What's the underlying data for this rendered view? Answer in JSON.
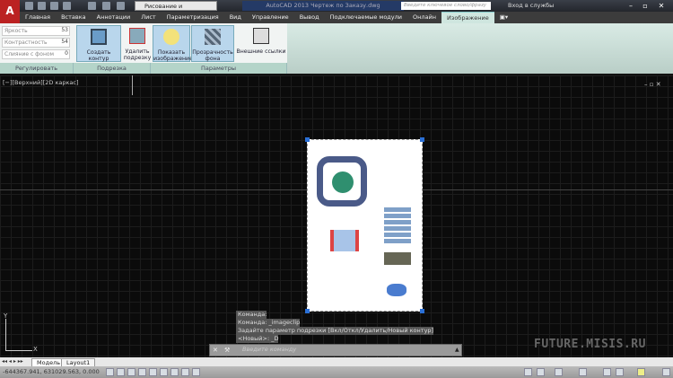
{
  "title_bar": {
    "workspace": "Рисование и аннотации",
    "title": "AutoCAD 2013   Чертеж по Заказу.dwg",
    "search_placeholder": "Введите ключевое слово/фразу",
    "login": "Вход в службы",
    "logo": "A"
  },
  "tabs": [
    "Главная",
    "Вставка",
    "Аннотации",
    "Лист",
    "Параметризация",
    "Вид",
    "Управление",
    "Вывод",
    "Подключаемые модули",
    "Онлайн",
    "Изображение"
  ],
  "active_tab": "Изображение",
  "ribbon": {
    "adjust": {
      "rows": [
        {
          "label": "Яркость",
          "value": "53"
        },
        {
          "label": "Контрастность",
          "value": "54"
        },
        {
          "label": "Слияние с фоном",
          "value": "0"
        }
      ],
      "panel": "Регулировать"
    },
    "clip": {
      "buttons": [
        "Создать контур подрезки",
        "Удалить подрезку"
      ],
      "panel": "Подрезка"
    },
    "options": {
      "buttons": [
        "Показать изображение",
        "Прозрачность фона",
        "Внешние ссылки"
      ],
      "panel": "Параметры"
    }
  },
  "viewport_label": "[−][Верхний][2D каркас]",
  "command": {
    "history": [
      "Команда:",
      "Команда:  _imageclip",
      "Задайте параметр подрезки [Вкл/Откл/Удалить/Новый контур]",
      "<Новый>:  _D"
    ],
    "placeholder": "Введите команду"
  },
  "watermark": "FUTURE.MISIS.RU",
  "layout_tabs": [
    "Модель",
    "Layout1"
  ],
  "status": {
    "coords": "-644367.941, 631029.563, 0.000"
  },
  "ucs": {
    "y": "Y",
    "x": "X"
  }
}
